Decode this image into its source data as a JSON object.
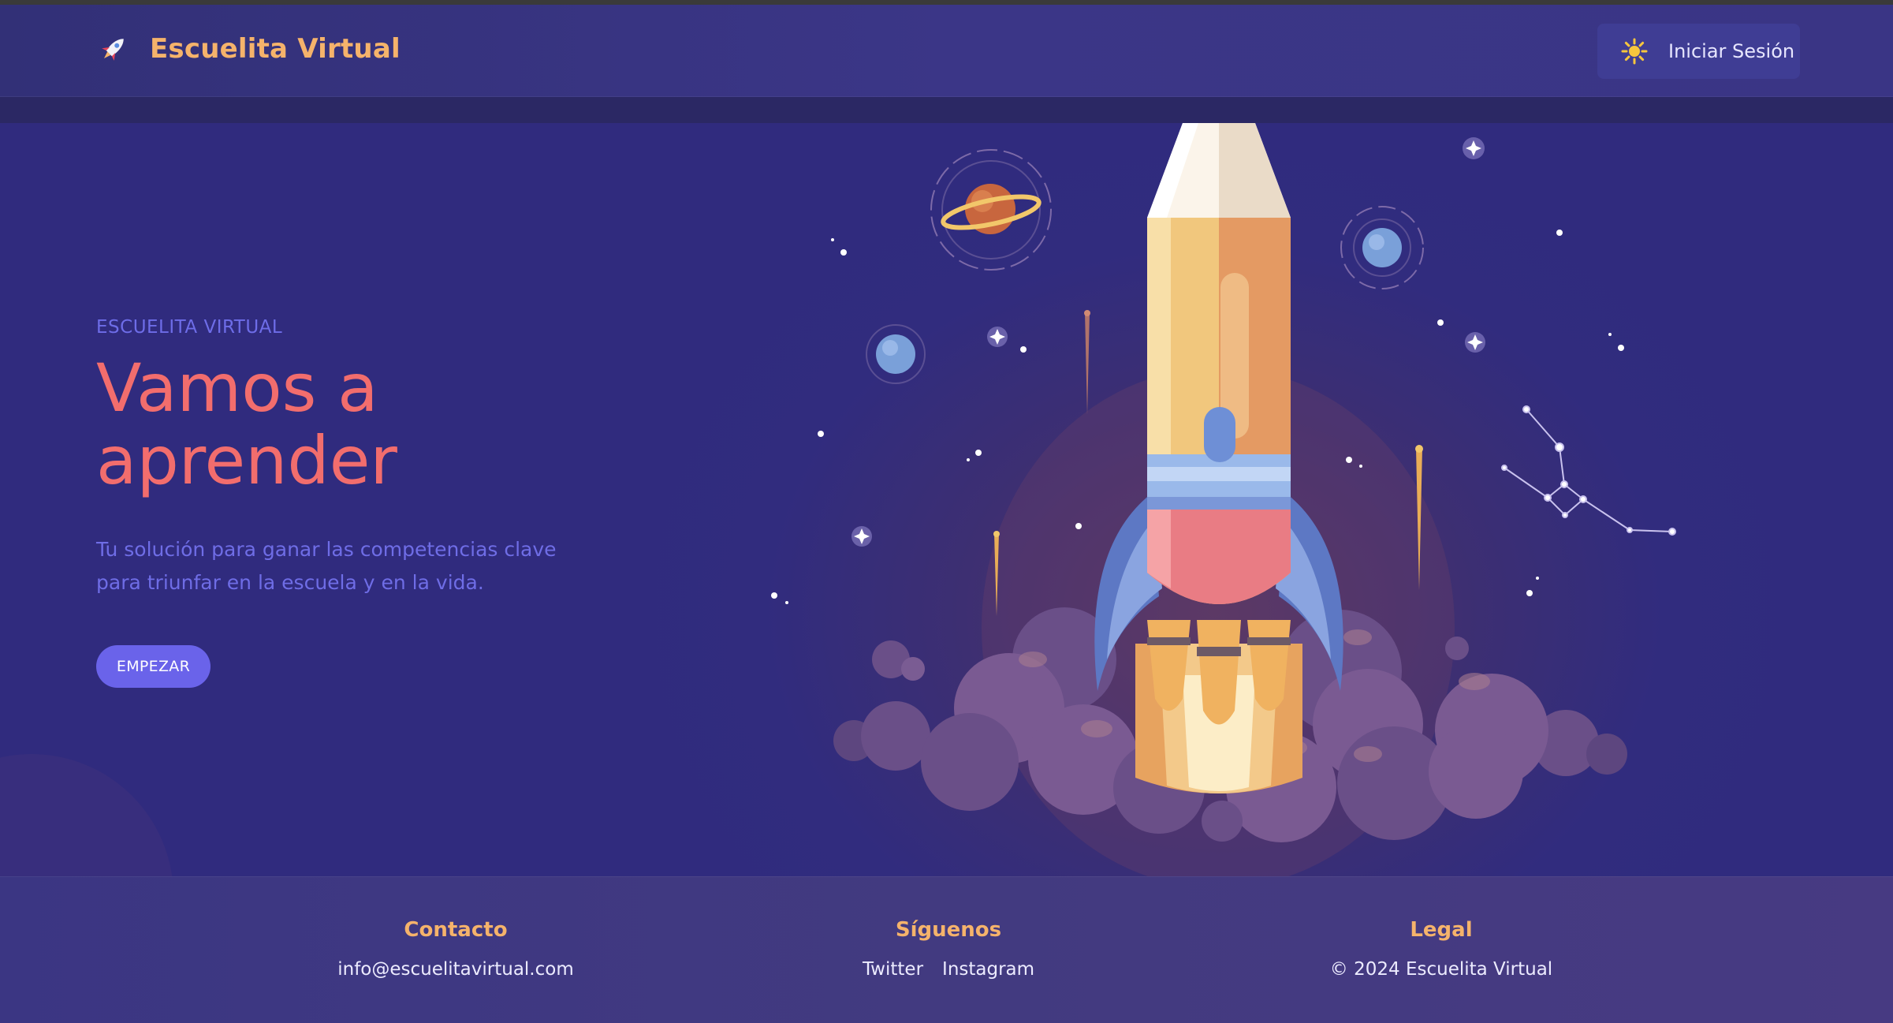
{
  "header": {
    "brand_name": "Escuelita Virtual",
    "login_label": "Iniciar Sesión",
    "icons": [
      "rocket-icon",
      "sun-icon"
    ]
  },
  "hero": {
    "eyebrow": "ESCUELITA VIRTUAL",
    "title": "Vamos a aprender",
    "subtitle": "Tu solución para ganar las competencias clave para triunfar en la escuela y en la vida.",
    "cta_label": "EMPEZAR"
  },
  "footer": {
    "contact": {
      "heading": "Contacto",
      "email": "info@escuelitavirtual.com"
    },
    "social": {
      "heading": "Síguenos",
      "links": [
        "Twitter",
        "Instagram"
      ]
    },
    "legal": {
      "heading": "Legal",
      "copyright": "© 2024 Escuelita Virtual"
    }
  },
  "colors": {
    "accent_orange": "#f5b36b",
    "title_coral": "#f26d6d",
    "primary_purple": "#6a63ea",
    "background": "#302b7e"
  }
}
